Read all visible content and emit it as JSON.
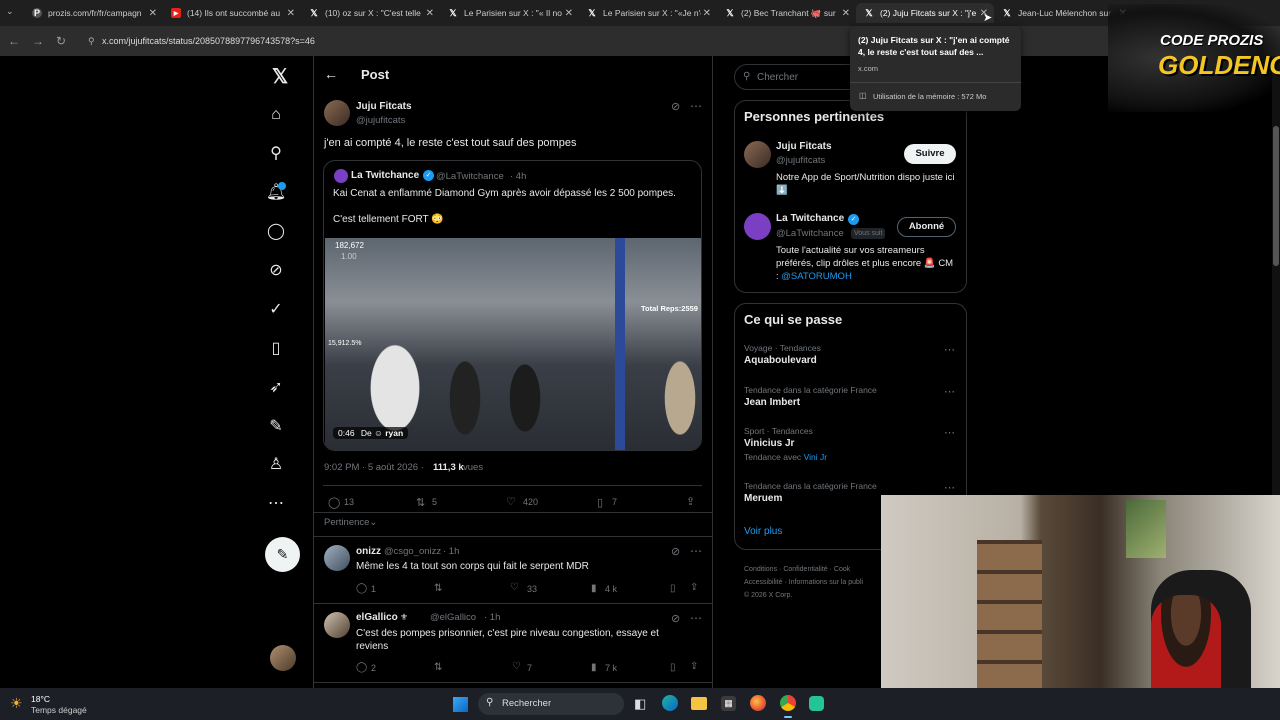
{
  "browser": {
    "tabs": [
      {
        "label": "prozis.com/fr/fr/campagn",
        "icon": "prozis-icon"
      },
      {
        "label": "(14) Ils ont succombé au",
        "icon": "youtube-icon"
      },
      {
        "label": "(10) oz sur X : \"C'est telle",
        "icon": "x-icon"
      },
      {
        "label": "Le Parisien sur X : \"« Il no",
        "icon": "x-icon"
      },
      {
        "label": "Le Parisien sur X : \"«Je n'e",
        "icon": "x-icon"
      },
      {
        "label": "(2) Bec Tranchant 🐙 sur",
        "icon": "x-icon"
      },
      {
        "label": "(2) Juju Fitcats sur X : \"j'e",
        "icon": "x-icon"
      },
      {
        "label": "Jean-Luc Mélenchon sur",
        "icon": "x-icon"
      }
    ],
    "url": "x.com/jujufitcats/status/2085078897796743578?s=46",
    "tooltip": {
      "title": "(2) Juju Fitcats sur X : \"j'en ai compté 4, le reste c'est tout sauf des ...",
      "domain": "x.com",
      "memory": "Utilisation de la mémoire : 572 Mo"
    }
  },
  "overlay": {
    "line1": "CODE PROZIS",
    "line2": "GOLDENG"
  },
  "header": {
    "title": "Post"
  },
  "post": {
    "author": "Juju Fitcats",
    "handle": "@jujufitcats",
    "text": "j'en ai compté 4, le reste c'est tout sauf des pompes",
    "quote": {
      "author": "La Twitchance",
      "handle": "@LaTwitchance",
      "time": "· 4h",
      "text1": "Kai Cenat a enflammé Diamond Gym après avoir dépassé les 2 500 pompes.",
      "text2": "C'est tellement FORT 😳",
      "video_viewers": "182,672",
      "video_speed": "1.00",
      "video_stat": "15,912.5%",
      "video_reps": "Total Reps:2559",
      "video_time": "0:46",
      "video_from": "De",
      "video_user": "ryan"
    },
    "meta_time": "9:02 PM · 5 août 2026 ·",
    "meta_views": "111,3 k",
    "meta_views_label": "vues",
    "replies": "13",
    "reposts": "5",
    "likes": "420",
    "bookmarks": "7",
    "sort": "Pertinence"
  },
  "replies": [
    {
      "author": "onizz",
      "handle": "@csgo_onizz",
      "time": "· 1h",
      "text": "Même les 4 ta tout son corps qui fait le serpent MDR",
      "replies": "1",
      "likes": "33",
      "views": "4 k"
    },
    {
      "author": "elGallico",
      "handle": "@elGallico",
      "time": "· 1h",
      "text": "C'est des pompes prisonnier,  c'est pire niveau congestion,  essaye et reviens",
      "replies": "2",
      "likes": "7",
      "views": "7 k"
    }
  ],
  "search": {
    "placeholder": "Chercher"
  },
  "relevant": {
    "title": "Personnes pertinentes",
    "people": [
      {
        "name": "Juju Fitcats",
        "handle": "@jujufitcats",
        "bio": "Notre App de Sport/Nutrition dispo juste ici ⬇️",
        "button": "Suivre",
        "badge": ""
      },
      {
        "name": "La Twitchance",
        "handle": "@LaTwitchance",
        "bio": "Toute l'actualité sur vos streameurs préférés, clip drôles et plus encore 🚨 CM :",
        "bio_link": "@SATORUMOH",
        "button": "Abonné",
        "badge": "Vous suit"
      }
    ]
  },
  "trends": {
    "title": "Ce qui se passe",
    "items": [
      {
        "category": "Voyage · Tendances",
        "name": "Aquaboulevard",
        "extra": "",
        "extra_link": ""
      },
      {
        "category": "Tendance dans la catégorie France",
        "name": "Jean Imbert",
        "extra": "",
        "extra_link": ""
      },
      {
        "category": "Sport · Tendances",
        "name": "Vinicius Jr",
        "extra": "Tendance avec",
        "extra_link": "Vini Jr"
      },
      {
        "category": "Tendance dans la catégorie France",
        "name": "Meruem",
        "extra": "",
        "extra_link": ""
      }
    ],
    "more": "Voir plus"
  },
  "footer": {
    "links": [
      "Conditions",
      "Confidentialité",
      "Cook",
      "Accessibilité",
      "Informations sur la publi"
    ],
    "copyright": "© 2026 X Corp."
  },
  "taskbar": {
    "weather_temp": "18°C",
    "weather_desc": "Temps dégagé",
    "search": "Rechercher"
  },
  "colors": {
    "accent": "#1d9bf0",
    "bg": "#000000",
    "muted": "#71767b",
    "border": "#2f3336"
  }
}
